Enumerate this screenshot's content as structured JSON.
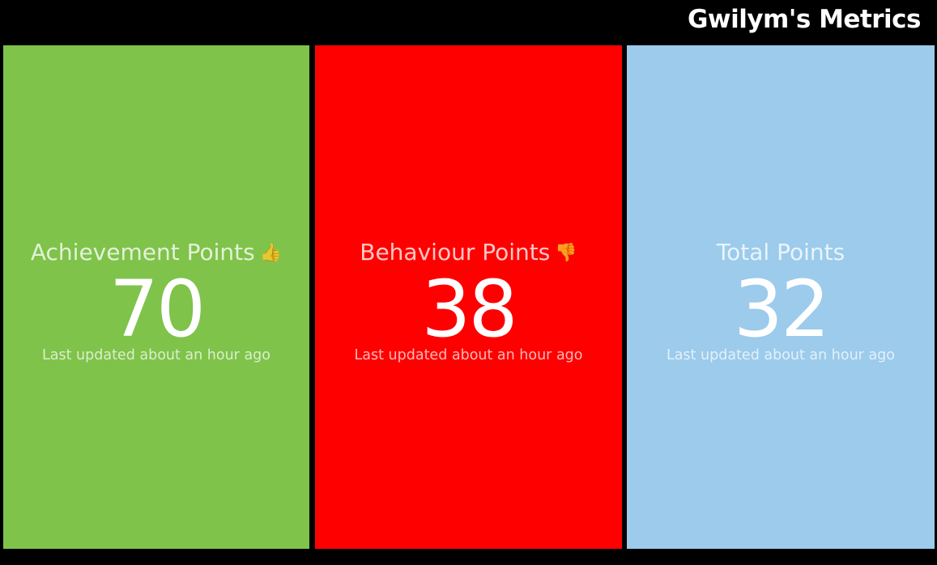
{
  "header": {
    "title": "Gwilym's Metrics"
  },
  "tiles": [
    {
      "title": "Achievement Points",
      "icon": "thumbs-up-icon",
      "emoji": "👍",
      "value": "70",
      "updated": "Last updated about an hour ago",
      "background": "#7fc34a"
    },
    {
      "title": "Behaviour Points",
      "icon": "thumbs-down-icon",
      "emoji": "👎",
      "value": "38",
      "updated": "Last updated about an hour ago",
      "background": "#ff0000"
    },
    {
      "title": "Total Points",
      "icon": "",
      "emoji": "",
      "value": "32",
      "updated": "Last updated about an hour ago",
      "background": "#9ccbeb"
    }
  ]
}
